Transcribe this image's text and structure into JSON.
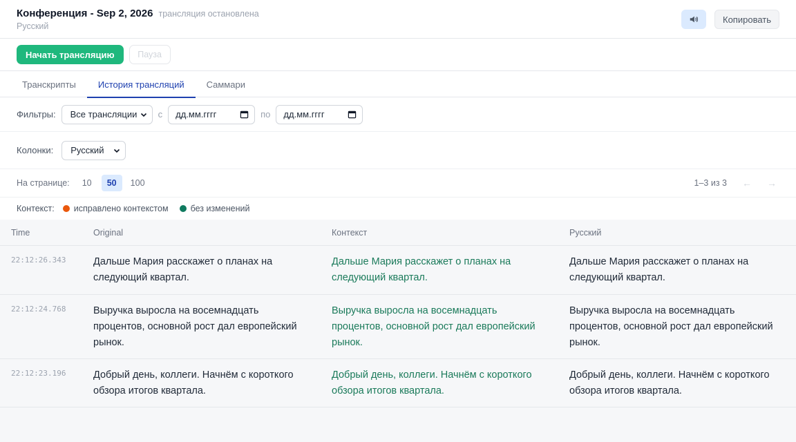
{
  "header": {
    "title": "Конференция - Sep 2, 2026",
    "status": "трансляция остановлена",
    "language": "Русский",
    "copy_label": "Копировать",
    "speaker_icon": "speaker-icon"
  },
  "controls": {
    "start_label": "Начать трансляцию",
    "pause_label": "Пауза"
  },
  "tabs": [
    {
      "label": "Транскрипты",
      "active": false
    },
    {
      "label": "История трансляций",
      "active": true
    },
    {
      "label": "Саммари",
      "active": false
    }
  ],
  "filters": {
    "label": "Фильтры:",
    "select_value": "Все трансляции",
    "from_label": "с",
    "to_label": "по",
    "from_placeholder": "дд.мм.гггг",
    "to_placeholder": "дд.мм.гггг"
  },
  "columns_filter": {
    "label": "Колонки:",
    "value": "Русский"
  },
  "pagination": {
    "label": "На странице:",
    "options": [
      "10",
      "50",
      "100"
    ],
    "active": "50",
    "range_text": "1–3 из 3",
    "prev": "←",
    "next": "→"
  },
  "context_legend": {
    "label": "Контекст:",
    "items": [
      {
        "label": "исправлено контекстом",
        "color": "#ea580c"
      },
      {
        "label": "без изменений",
        "color": "#0f7a5f"
      }
    ]
  },
  "table": {
    "headers": {
      "time": "Time",
      "original": "Original",
      "context": "Контекст",
      "russian": "Русский"
    },
    "rows": [
      {
        "time": "22:12:26.343",
        "original": "Дальше Мария расскажет о планах на следующий квартал.",
        "context": "Дальше Мария расскажет о планах на следующий квартал.",
        "russian": "Дальше Мария расскажет о планах на следующий квартал."
      },
      {
        "time": "22:12:24.768",
        "original": "Выручка выросла на восемнадцать процентов, основной рост дал европейский рынок.",
        "context": "Выручка выросла на восемнадцать процентов, основной рост дал европейский рынок.",
        "russian": "Выручка выросла на восемнадцать процентов, основной рост дал европейский рынок."
      },
      {
        "time": "22:12:23.196",
        "original": "Добрый день, коллеги. Начнём с короткого обзора итогов квартала.",
        "context": "Добрый день, коллеги. Начнём с короткого обзора итогов квартала.",
        "russian": "Добрый день, коллеги. Начнём с короткого обзора итогов квартала."
      }
    ]
  },
  "colors": {
    "accent_green": "#1fb87d",
    "accent_blue": "#1e40af",
    "context_text": "#1a7a5a"
  }
}
